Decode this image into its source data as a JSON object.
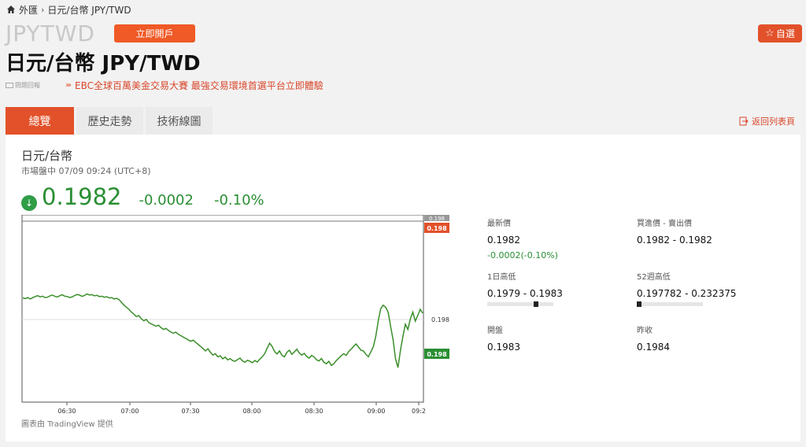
{
  "breadcrumb": {
    "root": "外匯",
    "current": "日元/台幣 JPY/TWD"
  },
  "header": {
    "symbol": "JPYTWD",
    "open_account": "立即開戶",
    "watchlist": "自選",
    "title": "日元/台幣 JPY/TWD"
  },
  "ad": {
    "label": "問題回報",
    "text": "EBC全球百萬美金交易大賽 最強交易環境首選平台立即體驗"
  },
  "tabs": [
    {
      "label": "總覽",
      "active": true
    },
    {
      "label": "歷史走勢",
      "active": false
    },
    {
      "label": "技術線圖",
      "active": false
    }
  ],
  "back_link": "返回列表頁",
  "quote": {
    "name": "日元/台幣",
    "status": "市場盤中 07/09 09:24 (UTC+8)",
    "price": "0.1982",
    "change": "-0.0002",
    "pct": "-0.10%"
  },
  "stats": {
    "last_label": "最新價",
    "last_value": "0.1982",
    "last_change": "-0.0002(-0.10%)",
    "bidask_label": "買進價 - 賣出價",
    "bidask_value": "0.1982 - 0.1982",
    "day_label": "1日高低",
    "day_value": "0.1979 - 0.1983",
    "day_pos": 0.75,
    "week52_label": "52週高低",
    "week52_value": "0.197782 - 0.232375",
    "week52_pos": 0.0,
    "open_label": "開盤",
    "open_value": "0.1983",
    "prev_label": "昨收",
    "prev_value": "0.1984"
  },
  "credit": "圖表由 TradingView 提供",
  "colors": {
    "accent": "#e2512a",
    "down": "#2a8f33",
    "line": "#3a8f2a"
  },
  "chart_data": {
    "type": "line",
    "x_ticks": [
      "06:30",
      "07:00",
      "07:30",
      "08:00",
      "08:30",
      "09:00",
      "09:2"
    ],
    "y_tick": "0.198",
    "price_tags": [
      {
        "label": "0.198",
        "color": "#e2512a"
      },
      {
        "label": "0.198",
        "color": "#2a8f33"
      }
    ],
    "top_tag": "0.198",
    "series": [
      {
        "values": [
          0.602,
          0.598,
          0.604,
          0.596,
          0.603,
          0.61,
          0.615,
          0.608,
          0.612,
          0.604,
          0.606,
          0.614,
          0.618,
          0.611,
          0.607,
          0.615,
          0.62,
          0.612,
          0.61,
          0.604,
          0.608,
          0.616,
          0.622,
          0.618,
          0.611,
          0.616,
          0.625,
          0.619,
          0.621,
          0.614,
          0.617,
          0.61,
          0.612,
          0.606,
          0.609,
          0.602,
          0.604,
          0.596,
          0.6,
          0.592,
          0.576,
          0.56,
          0.548,
          0.536,
          0.52,
          0.508,
          0.494,
          0.5,
          0.482,
          0.47,
          0.478,
          0.46,
          0.452,
          0.446,
          0.438,
          0.444,
          0.43,
          0.42,
          0.426,
          0.414,
          0.405,
          0.398,
          0.404,
          0.392,
          0.384,
          0.376,
          0.368,
          0.36,
          0.352,
          0.358,
          0.346,
          0.334,
          0.322,
          0.31,
          0.296,
          0.308,
          0.288,
          0.272,
          0.28,
          0.262,
          0.268,
          0.25,
          0.26,
          0.244,
          0.252,
          0.24,
          0.236,
          0.246,
          0.254,
          0.238,
          0.23,
          0.242,
          0.236,
          0.228,
          0.24,
          0.232,
          0.248,
          0.262,
          0.28,
          0.312,
          0.34,
          0.322,
          0.292,
          0.278,
          0.296,
          0.27,
          0.262,
          0.288,
          0.3,
          0.276,
          0.29,
          0.306,
          0.284,
          0.272,
          0.282,
          0.264,
          0.254,
          0.27,
          0.262,
          0.244,
          0.238,
          0.252,
          0.23,
          0.222,
          0.236,
          0.212,
          0.222,
          0.24,
          0.254,
          0.268,
          0.28,
          0.27,
          0.292,
          0.306,
          0.322,
          0.336,
          0.318,
          0.3,
          0.296,
          0.276,
          0.262,
          0.29,
          0.32,
          0.38,
          0.47,
          0.54,
          0.56,
          0.548,
          0.52,
          0.44,
          0.36,
          0.25,
          0.2,
          0.3,
          0.38,
          0.45,
          0.42,
          0.48,
          0.52,
          0.468,
          0.5,
          0.536,
          0.514
        ]
      }
    ]
  }
}
